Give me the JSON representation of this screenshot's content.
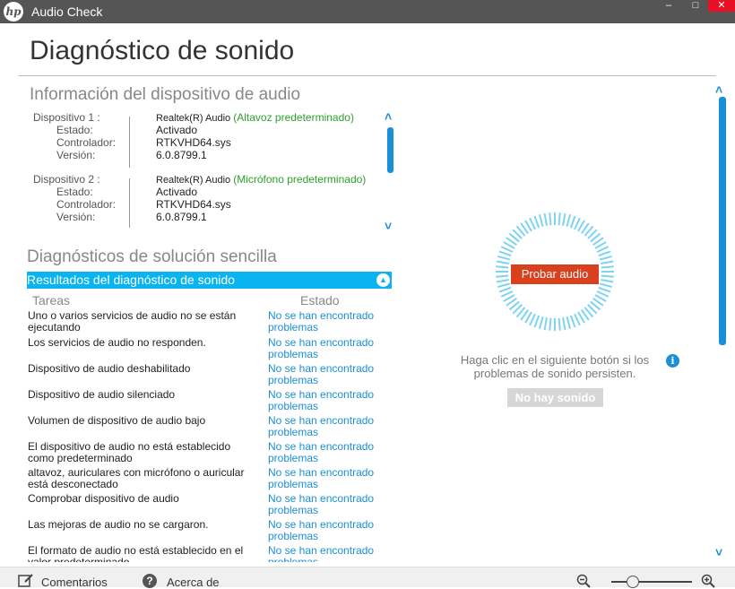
{
  "window": {
    "title": "Audio Check",
    "logo": "hp",
    "min": "–",
    "max": "□",
    "close": "✕"
  },
  "page": {
    "title": "Diagnóstico de sonido"
  },
  "device_info": {
    "heading": "Información del dispositivo de audio",
    "devices": [
      {
        "label": "Dispositivo 1 :",
        "name": "Realtek(R) Audio",
        "tag": "(Altavoz predeterminado)",
        "rows": [
          {
            "k": "Estado:",
            "v": "Activado"
          },
          {
            "k": "Controlador:",
            "v": "RTKVHD64.sys"
          },
          {
            "k": "Versión:",
            "v": "6.0.8799.1"
          }
        ]
      },
      {
        "label": "Dispositivo 2 :",
        "name": "Realtek(R) Audio",
        "tag": "(Micrófono predeterminado)",
        "rows": [
          {
            "k": "Estado:",
            "v": "Activado"
          },
          {
            "k": "Controlador:",
            "v": "RTKVHD64.sys"
          },
          {
            "k": "Versión:",
            "v": "6.0.8799.1"
          }
        ]
      }
    ],
    "scroll_up": "˄",
    "scroll_down": "˅"
  },
  "diagnostics": {
    "heading": "Diagnósticos de solución sencilla",
    "results_label": "Resultados del diagnóstico de sonido",
    "collapse_icon": "chevron-up-icon",
    "col_tasks": "Tareas",
    "col_status": "Estado",
    "tasks": [
      {
        "name": "Uno o varios servicios de audio no se están ejecutando",
        "status": "No se han encontrado problemas"
      },
      {
        "name": "Los servicios de audio no responden.",
        "status": "No se han encontrado problemas"
      },
      {
        "name": "Dispositivo de audio deshabilitado",
        "status": "No se han encontrado problemas"
      },
      {
        "name": "Dispositivo de audio silenciado",
        "status": "No se han encontrado problemas"
      },
      {
        "name": "Volumen de dispositivo de audio bajo",
        "status": "No se han encontrado problemas"
      },
      {
        "name": "El dispositivo de audio no está establecido como predeterminado",
        "status": "No se han encontrado problemas"
      },
      {
        "name": "altavoz, auriculares con micrófono o auricular está desconectado",
        "status": "No se han encontrado problemas"
      },
      {
        "name": "Comprobar dispositivo de audio",
        "status": "No se han encontrado problemas"
      },
      {
        "name": "Las mejoras de audio no se cargaron.",
        "status": "No se han encontrado problemas"
      },
      {
        "name": "El formato de audio no está establecido en el valor predeterminado",
        "status": "No se han encontrado problemas"
      }
    ]
  },
  "audio_test": {
    "button": "Probar audio",
    "hint": "Haga clic en el siguiente botón si los problemas de sonido persisten.",
    "info_glyph": "i",
    "no_sound": "No hay sonido"
  },
  "footer": {
    "comments": "Comentarios",
    "about": "Acerca de",
    "help_glyph": "?",
    "zoom_out_icon": "zoom-out-icon",
    "zoom_in_icon": "zoom-in-icon",
    "zoom_level": 0.2
  },
  "colors": {
    "accent": "#1b8fd6",
    "results_bar": "#0ab4f0",
    "test_button": "#d9401e",
    "default_tag": "#2ca02c",
    "titlebar": "#555555"
  }
}
